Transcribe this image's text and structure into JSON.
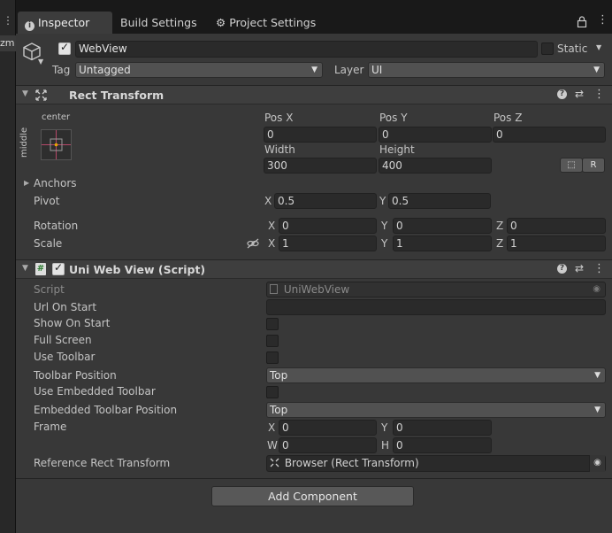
{
  "left_strip": {
    "dots": "⋮",
    "label": "zm"
  },
  "tabs": [
    {
      "label": "Inspector",
      "icon": "info-icon"
    },
    {
      "label": "Build Settings"
    },
    {
      "label": "Project Settings",
      "icon": "gear-icon"
    }
  ],
  "tabbar_actions": {
    "lock": "🔒",
    "menu": "⋮"
  },
  "gameobject": {
    "name": "WebView",
    "active": true,
    "static_label": "Static",
    "static": false,
    "tag_label": "Tag",
    "tag_value": "Untagged",
    "layer_label": "Layer",
    "layer_value": "UI"
  },
  "rect_transform": {
    "title": "Rect Transform",
    "anchor_h": "center",
    "anchor_v": "middle",
    "pos_x_label": "Pos X",
    "pos_x": "0",
    "pos_y_label": "Pos Y",
    "pos_y": "0",
    "pos_z_label": "Pos Z",
    "pos_z": "0",
    "width_label": "Width",
    "width": "300",
    "height_label": "Height",
    "height": "400",
    "r_button": "R",
    "anchors_label": "Anchors",
    "pivot_label": "Pivot",
    "pivot_x": "0.5",
    "pivot_y": "0.5",
    "rotation_label": "Rotation",
    "rot_x": "0",
    "rot_y": "0",
    "rot_z": "0",
    "scale_label": "Scale",
    "scale_x": "1",
    "scale_y": "1",
    "scale_z": "1",
    "x": "X",
    "y": "Y",
    "z": "Z"
  },
  "uniwebview": {
    "title": "Uni Web View (Script)",
    "enabled": true,
    "script_label": "Script",
    "script_value": "UniWebView",
    "url_on_start_label": "Url On Start",
    "url_on_start": "",
    "show_on_start_label": "Show On Start",
    "full_screen_label": "Full Screen",
    "use_toolbar_label": "Use Toolbar",
    "toolbar_position_label": "Toolbar Position",
    "toolbar_position": "Top",
    "use_embedded_toolbar_label": "Use Embedded Toolbar",
    "embedded_toolbar_position_label": "Embedded Toolbar Position",
    "embedded_toolbar_position": "Top",
    "frame_label": "Frame",
    "frame_x": "0",
    "frame_y": "0",
    "frame_w": "0",
    "frame_h": "0",
    "x": "X",
    "y": "Y",
    "w": "W",
    "h": "H",
    "reference_label": "Reference Rect Transform",
    "reference_value": "Browser (Rect Transform)"
  },
  "add_component": "Add Component",
  "colors": {
    "panel": "#383838",
    "field": "#2a2a2a",
    "header": "#3e3e3e",
    "accent": "#3a79bb"
  }
}
